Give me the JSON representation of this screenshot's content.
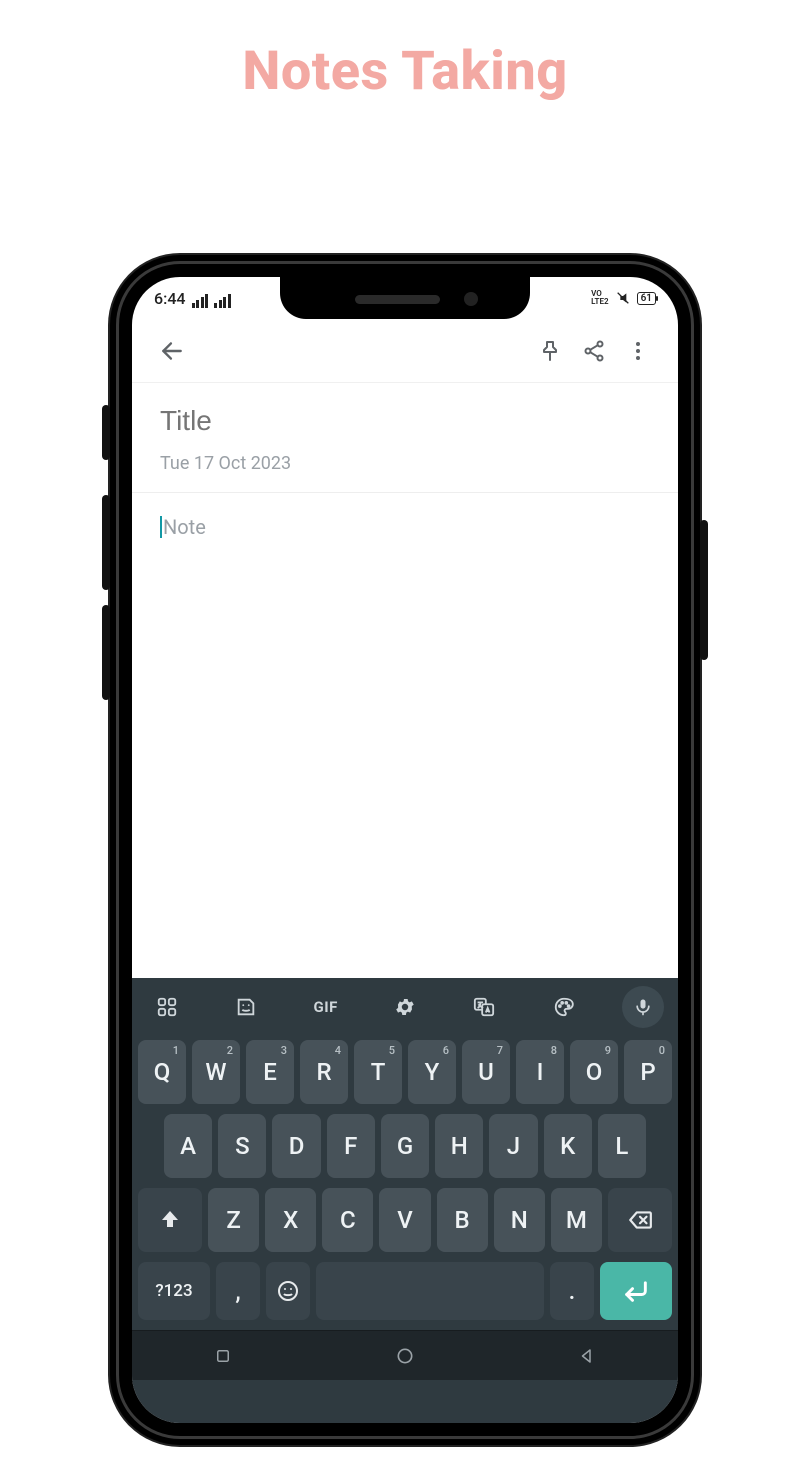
{
  "page_heading": "Notes Taking",
  "status": {
    "time": "6:44",
    "net_badge": "VO\nLTE2",
    "battery": "61"
  },
  "editor": {
    "title_placeholder": "Title",
    "date": "Tue 17 Oct 2023",
    "note_placeholder": "Note"
  },
  "keyboard": {
    "toolbar": {
      "gif": "GIF"
    },
    "row1": [
      {
        "l": "Q",
        "s": "1"
      },
      {
        "l": "W",
        "s": "2"
      },
      {
        "l": "E",
        "s": "3"
      },
      {
        "l": "R",
        "s": "4"
      },
      {
        "l": "T",
        "s": "5"
      },
      {
        "l": "Y",
        "s": "6"
      },
      {
        "l": "U",
        "s": "7"
      },
      {
        "l": "I",
        "s": "8"
      },
      {
        "l": "O",
        "s": "9"
      },
      {
        "l": "P",
        "s": "0"
      }
    ],
    "row2": [
      "A",
      "S",
      "D",
      "F",
      "G",
      "H",
      "J",
      "K",
      "L"
    ],
    "row3": [
      "Z",
      "X",
      "C",
      "V",
      "B",
      "N",
      "M"
    ],
    "row4": {
      "symnum": "?123",
      "comma": ",",
      "period": "."
    }
  }
}
